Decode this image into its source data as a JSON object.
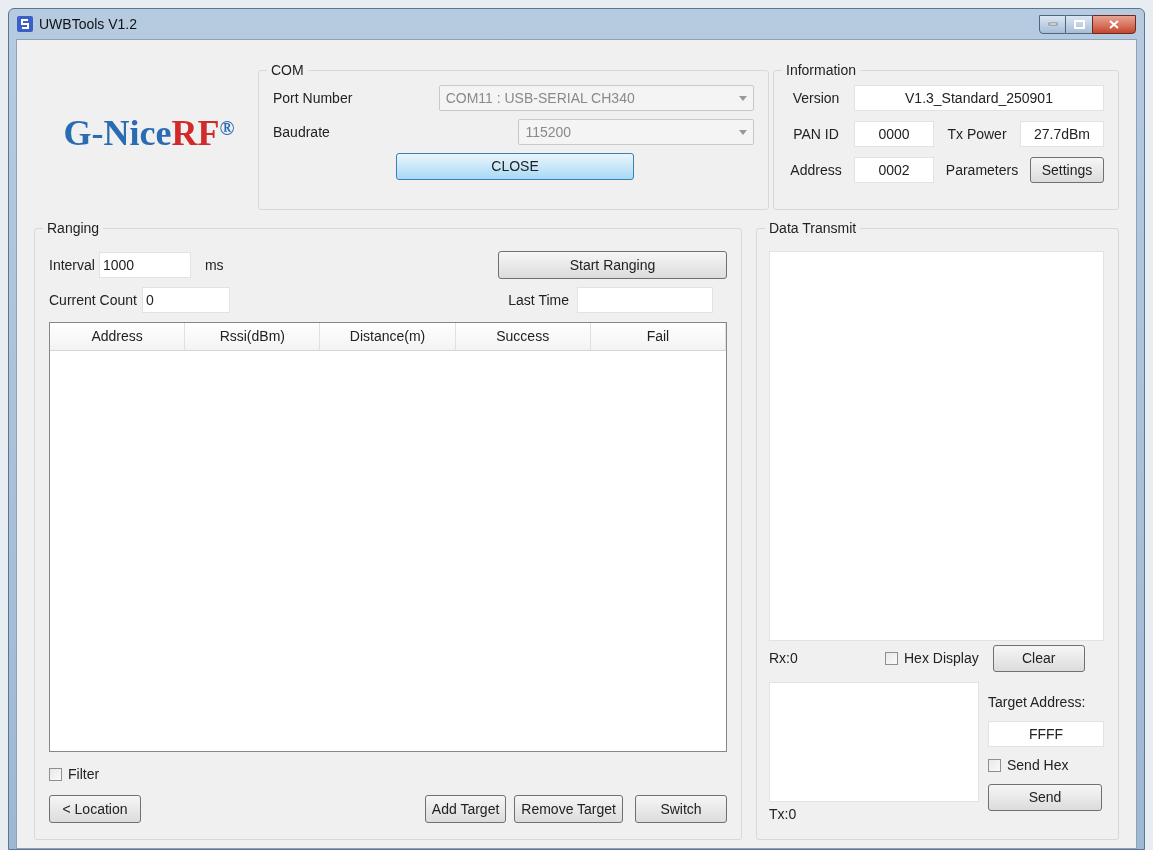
{
  "window": {
    "title": "UWBTools V1.2"
  },
  "logo": {
    "text": "G-Nice",
    "accent": "RF",
    "mark": "®"
  },
  "com": {
    "title": "COM",
    "port_label": "Port Number",
    "port_value": "COM11 : USB-SERIAL CH340",
    "baud_label": "Baudrate",
    "baud_value": "115200",
    "button": "CLOSE"
  },
  "information": {
    "title": "Information",
    "version_label": "Version",
    "version": "V1.3_Standard_250901",
    "pan_label": "PAN ID",
    "pan": "0000",
    "tx_label": "Tx Power",
    "tx": "27.7dBm",
    "address_label": "Address",
    "address": "0002",
    "params_label": "Parameters",
    "settings_button": "Settings"
  },
  "ranging": {
    "title": "Ranging",
    "interval_label": "Interval",
    "interval": "1000",
    "interval_unit": "ms",
    "start_button": "Start Ranging",
    "count_label": "Current Count",
    "count": "0",
    "last_time_label": "Last Time",
    "table": {
      "columns": [
        "Address",
        "Rssi(dBm)",
        "Distance(m)",
        "Success",
        "Fail"
      ]
    },
    "filter": {
      "label": "Filter",
      "checked": false
    },
    "buttons": [
      {
        "label": "< Location"
      },
      {
        "label": "Add Target"
      },
      {
        "label": "Remove Target"
      },
      {
        "label": "Switch"
      }
    ]
  },
  "data_transmit": {
    "title": "Data Transmit",
    "rx": "Rx:0",
    "hex_display": {
      "label": "Hex Display",
      "checked": false
    },
    "clear_button": "Clear",
    "target_label": "Target Address:",
    "target": "FFFF",
    "send_hex": {
      "label": "Send Hex",
      "checked": false
    },
    "send_button": "Send",
    "tx": "Tx:0"
  }
}
